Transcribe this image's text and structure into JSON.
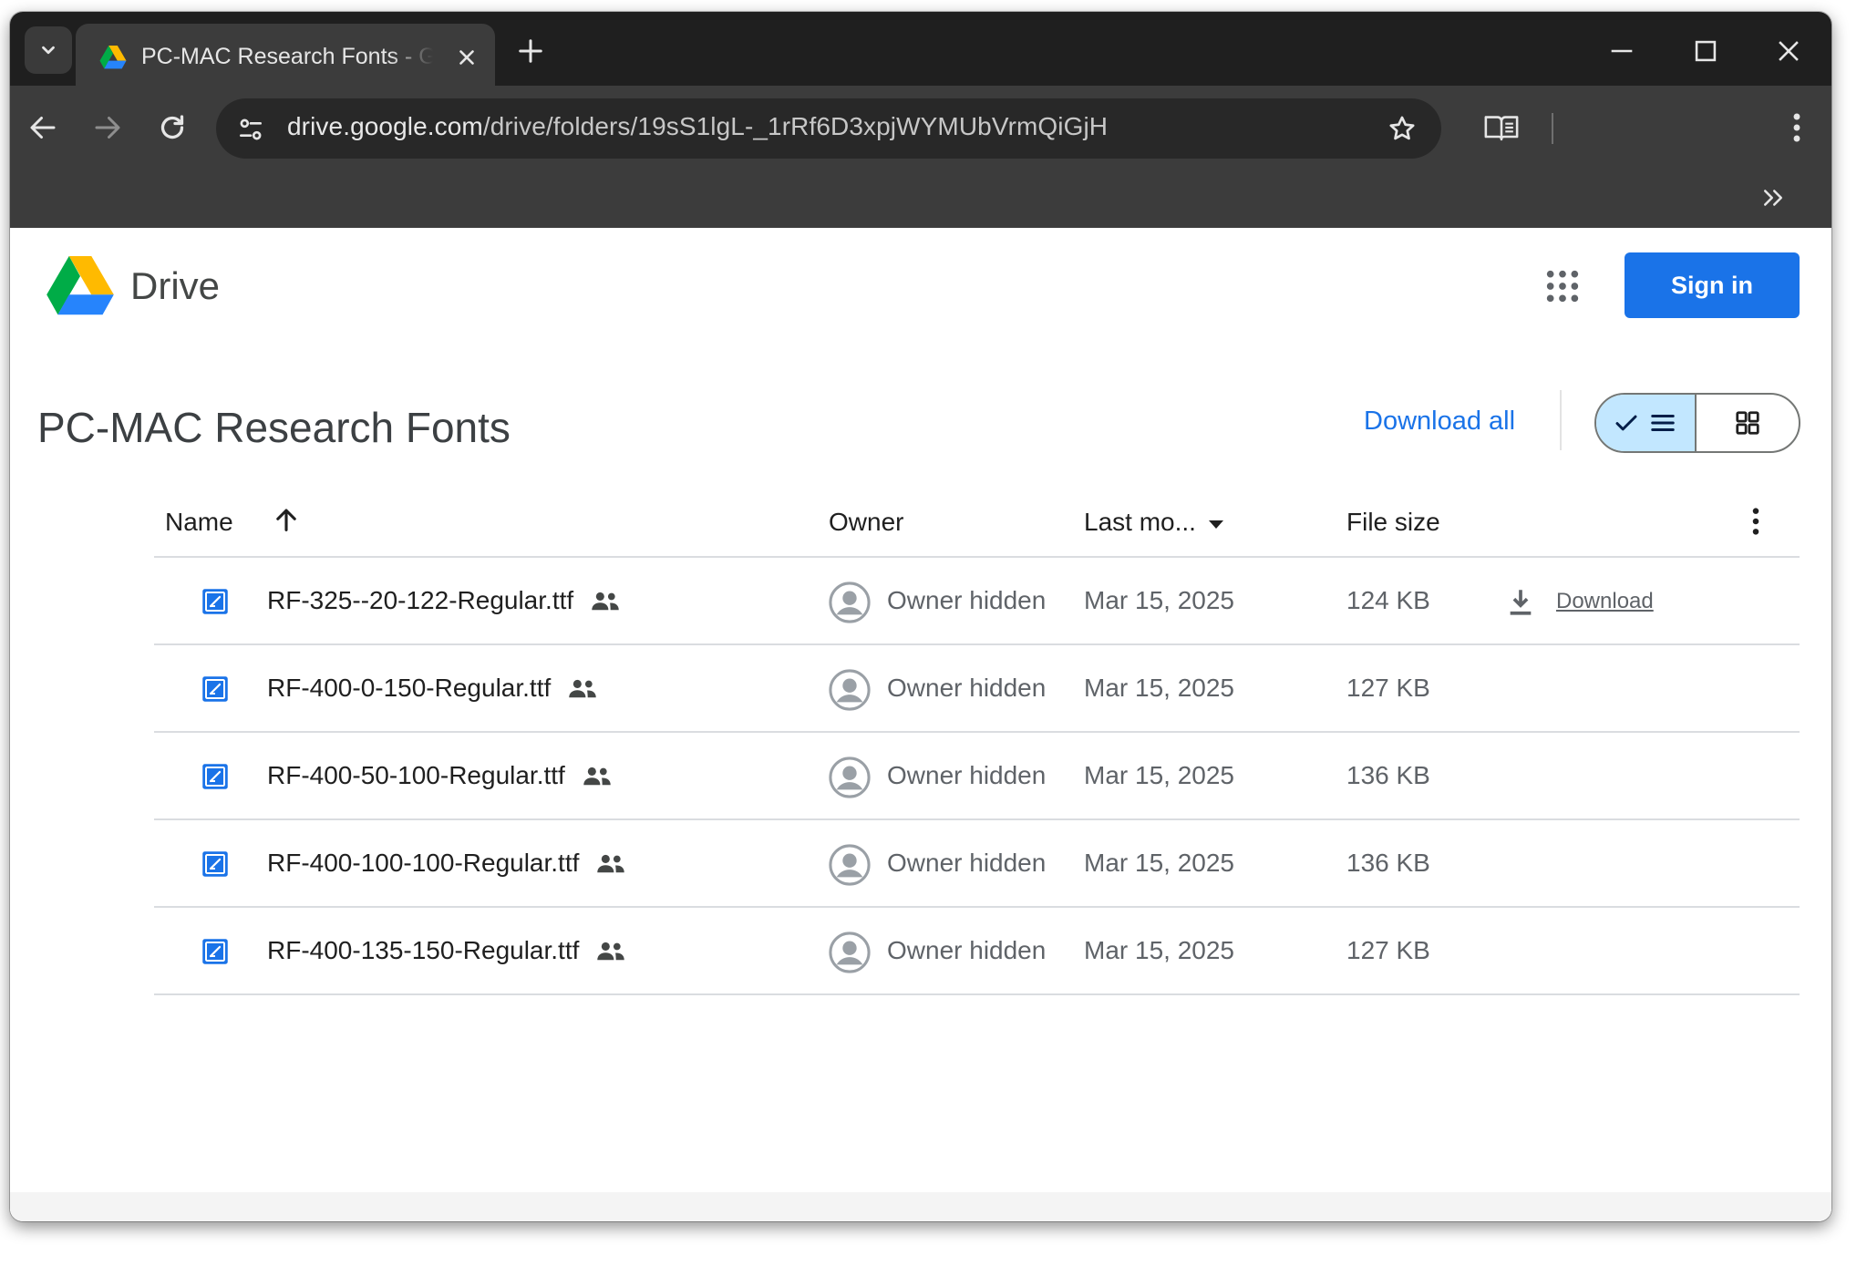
{
  "browser": {
    "tab_title": "PC-MAC Research Fonts - Google Drive",
    "url_host": "drive.google.com",
    "url_path": "/drive/folders/19sS1lgL-_1rRf6D3xpjWYMUbVrmQiGjH"
  },
  "drive": {
    "product_name": "Drive",
    "sign_in_label": "Sign in"
  },
  "folder": {
    "title": "PC-MAC Research Fonts",
    "download_all_label": "Download all",
    "view_mode": "list"
  },
  "table": {
    "columns": {
      "name": "Name",
      "owner": "Owner",
      "modified": "Last mo...",
      "size": "File size"
    },
    "row_download_label": "Download",
    "rows": [
      {
        "name": "RF-325--20-122-Regular.ttf",
        "owner": "Owner hidden",
        "modified": "Mar 15, 2025",
        "size": "124 KB"
      },
      {
        "name": "RF-400-0-150-Regular.ttf",
        "owner": "Owner hidden",
        "modified": "Mar 15, 2025",
        "size": "127 KB"
      },
      {
        "name": "RF-400-50-100-Regular.ttf",
        "owner": "Owner hidden",
        "modified": "Mar 15, 2025",
        "size": "136 KB"
      },
      {
        "name": "RF-400-100-100-Regular.ttf",
        "owner": "Owner hidden",
        "modified": "Mar 15, 2025",
        "size": "136 KB"
      },
      {
        "name": "RF-400-135-150-Regular.ttf",
        "owner": "Owner hidden",
        "modified": "Mar 15, 2025",
        "size": "127 KB"
      }
    ]
  },
  "icons": {
    "file": "font-file-icon",
    "shared": "shared-people-icon",
    "owner": "avatar-placeholder-icon",
    "download": "download-arrow-icon"
  },
  "colors": {
    "accent": "#1a73e8",
    "view_toggle_active": "#c2e7ff",
    "file_icon": "#1a73e8",
    "chrome_dark": "#1f1f1f",
    "chrome_toolbar": "#3c3c3c"
  }
}
